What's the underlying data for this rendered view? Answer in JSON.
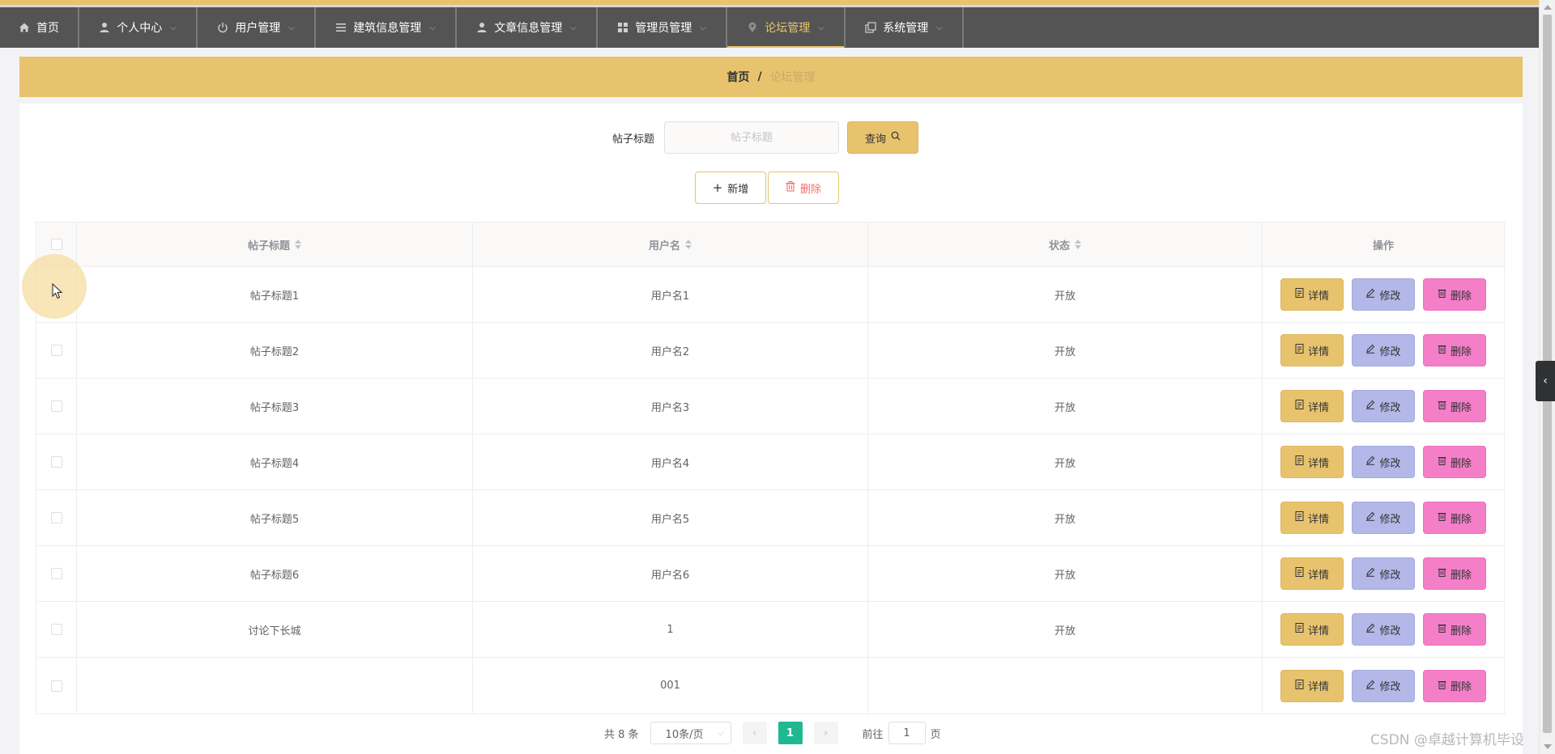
{
  "nav": {
    "items": [
      {
        "label": "首页",
        "icon": "home-icon"
      },
      {
        "label": "个人中心",
        "icon": "user-icon"
      },
      {
        "label": "用户管理",
        "icon": "power-icon"
      },
      {
        "label": "建筑信息管理",
        "icon": "list-icon"
      },
      {
        "label": "文章信息管理",
        "icon": "user-icon"
      },
      {
        "label": "管理员管理",
        "icon": "grid-icon"
      },
      {
        "label": "论坛管理",
        "icon": "location-icon",
        "active": true
      },
      {
        "label": "系统管理",
        "icon": "copy-icon"
      }
    ],
    "active_color": "#e8c36e"
  },
  "breadcrumb": {
    "home": "首页",
    "separator": "/",
    "current": "论坛管理"
  },
  "search": {
    "label": "帖子标题",
    "placeholder": "帖子标题",
    "value": "",
    "button": "查询"
  },
  "actions": {
    "add": "新增",
    "delete": "删除"
  },
  "table": {
    "columns": [
      "帖子标题",
      "用户名",
      "状态",
      "操作"
    ],
    "rows": [
      {
        "title": "帖子标题1",
        "user": "用户名1",
        "status": "开放"
      },
      {
        "title": "帖子标题2",
        "user": "用户名2",
        "status": "开放"
      },
      {
        "title": "帖子标题3",
        "user": "用户名3",
        "status": "开放"
      },
      {
        "title": "帖子标题4",
        "user": "用户名4",
        "status": "开放"
      },
      {
        "title": "帖子标题5",
        "user": "用户名5",
        "status": "开放"
      },
      {
        "title": "帖子标题6",
        "user": "用户名6",
        "status": "开放"
      },
      {
        "title": "讨论下长城",
        "user": "1",
        "status": "开放"
      },
      {
        "title": "",
        "user": "001",
        "status": ""
      }
    ],
    "ops": {
      "detail": "详情",
      "edit": "修改",
      "delete": "删除"
    }
  },
  "pagination": {
    "total_text": "共 8 条",
    "page_size": "10条/页",
    "current_page": "1",
    "goto_prefix": "前往",
    "goto_value": "1",
    "goto_suffix": "页"
  },
  "watermark": "CSDN @卓越计算机毕设",
  "colors": {
    "theme": "#e8c36e",
    "nav_bg": "#545454",
    "edit": "#b3b8e8",
    "delete": "#f47fc8",
    "page_active": "#1fb991"
  }
}
